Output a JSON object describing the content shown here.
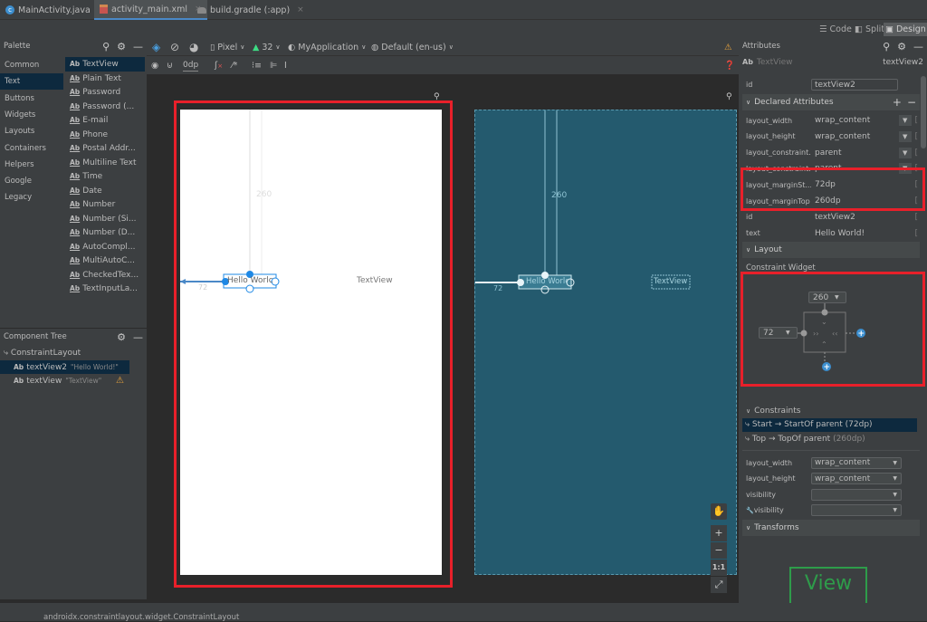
{
  "tabs": [
    {
      "label": "MainActivity.java",
      "icon": "java-class-icon",
      "active": false
    },
    {
      "label": "activity_main.xml",
      "icon": "xml-layout-icon",
      "active": true
    },
    {
      "label": "build.gradle (:app)",
      "icon": "gradle-icon",
      "active": false
    }
  ],
  "modes": {
    "code": "Code",
    "split": "Split",
    "design": "Design"
  },
  "palette": {
    "title": "Palette",
    "categories": [
      "Common",
      "Text",
      "Buttons",
      "Widgets",
      "Layouts",
      "Containers",
      "Helpers",
      "Google",
      "Legacy"
    ],
    "selected_category": "Text",
    "items": [
      "TextView",
      "Plain Text",
      "Password",
      "Password (...",
      "E-mail",
      "Phone",
      "Postal Addr...",
      "Multiline Text",
      "Time",
      "Date",
      "Number",
      "Number (Si...",
      "Number (D...",
      "AutoCompl...",
      "MultiAutoC...",
      "CheckedTex...",
      "TextInputLa..."
    ]
  },
  "component_tree": {
    "title": "Component Tree",
    "root": "ConstraintLayout",
    "children": [
      {
        "type": "Ab",
        "id": "textView2",
        "text": "\"Hello World!\"",
        "selected": true,
        "warning": false
      },
      {
        "type": "Ab",
        "id": "textView",
        "text": "\"TextView\"",
        "selected": false,
        "warning": true
      }
    ]
  },
  "toolbar": {
    "device": "Pixel",
    "api": "32",
    "theme": "MyApplication",
    "locale": "Default (en-us)",
    "margin": "0dp"
  },
  "canvas": {
    "hello_text": "Hello World!",
    "hello_text_clipped": "Hello Worlc",
    "textview_text": "TextView",
    "margin_top_label": "260",
    "margin_start_label": "72",
    "zoom_fit_label": "1:1"
  },
  "attributes": {
    "title": "Attributes",
    "widget_type": "TextView",
    "widget_id": "textView2",
    "id_label": "id",
    "id_value": "textView2",
    "declared_title": "Declared Attributes",
    "declared": [
      {
        "name": "layout_width",
        "value": "wrap_content",
        "dropdown": true
      },
      {
        "name": "layout_height",
        "value": "wrap_content",
        "dropdown": true
      },
      {
        "name": "layout_constraint...",
        "value": "parent",
        "dropdown": true
      },
      {
        "name": "layout_constraint...",
        "value": "parent",
        "dropdown": true
      },
      {
        "name": "layout_marginSt...",
        "value": "72dp",
        "dropdown": false
      },
      {
        "name": "layout_marginTop",
        "value": "260dp",
        "dropdown": false
      },
      {
        "name": "id",
        "value": "textView2",
        "dropdown": false
      },
      {
        "name": "text",
        "value": "Hello World!",
        "dropdown": false
      }
    ],
    "layout_title": "Layout",
    "constraint_widget_title": "Constraint Widget",
    "cw_top": "260",
    "cw_start": "72",
    "constraints_title": "Constraints",
    "constraints": [
      {
        "label": "Start → StartOf parent",
        "value": "(72dp)",
        "selected": true
      },
      {
        "label": "Top → TopOf parent",
        "value": "(260dp)",
        "selected": false
      }
    ],
    "layout_attrs": [
      {
        "name": "layout_width",
        "value": "wrap_content"
      },
      {
        "name": "layout_height",
        "value": "wrap_content"
      },
      {
        "name": "visibility",
        "value": ""
      },
      {
        "name": "visibility",
        "value": ""
      }
    ],
    "transforms_title": "Transforms",
    "preview_label": "View"
  },
  "status": {
    "text": "androidx.constraintlayout.widget.ConstraintLayout"
  },
  "colors": {
    "accent": "#4a88c7",
    "highlight": "#e8202a",
    "blueprint": "#245a6e",
    "selection": "#0d293e"
  }
}
